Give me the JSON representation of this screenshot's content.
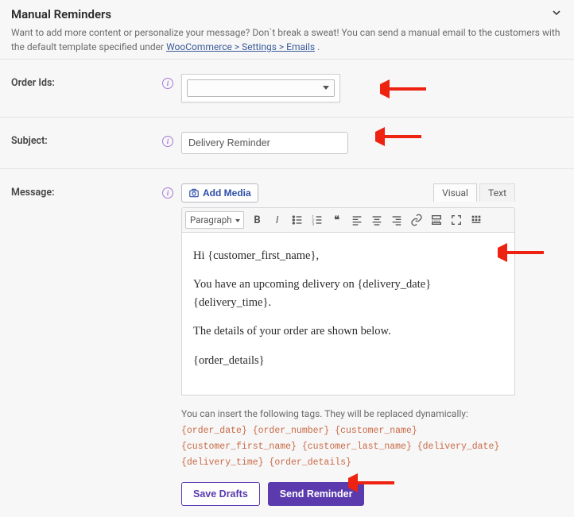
{
  "header": {
    "title": "Manual Reminders",
    "desc_before": "Want to add more content or personalize your message? Don`t break a sweat! You can send a manual email to the customers with the default template specified under ",
    "desc_link": "WooCommerce > Settings > Emails",
    "desc_after": " ."
  },
  "order_ids": {
    "label": "Order Ids:"
  },
  "subject": {
    "label": "Subject:",
    "value": "Delivery Reminder"
  },
  "message": {
    "label": "Message:",
    "add_media": "Add Media",
    "tab_visual": "Visual",
    "tab_text": "Text",
    "format": "Paragraph",
    "body": {
      "p1": "Hi {customer_first_name},",
      "p2": "You have an upcoming delivery on {delivery_date} {delivery_time}.",
      "p3": "The details of your order are shown below.",
      "p4": "{order_details}"
    },
    "hint_prefix": "You can insert the following tags. They will be replaced dynamically: ",
    "tags": "{order_date} {order_number} {customer_name} {customer_first_name} {customer_last_name} {delivery_date} {delivery_time} {order_details}"
  },
  "buttons": {
    "save": "Save Drafts",
    "send": "Send Reminder"
  }
}
